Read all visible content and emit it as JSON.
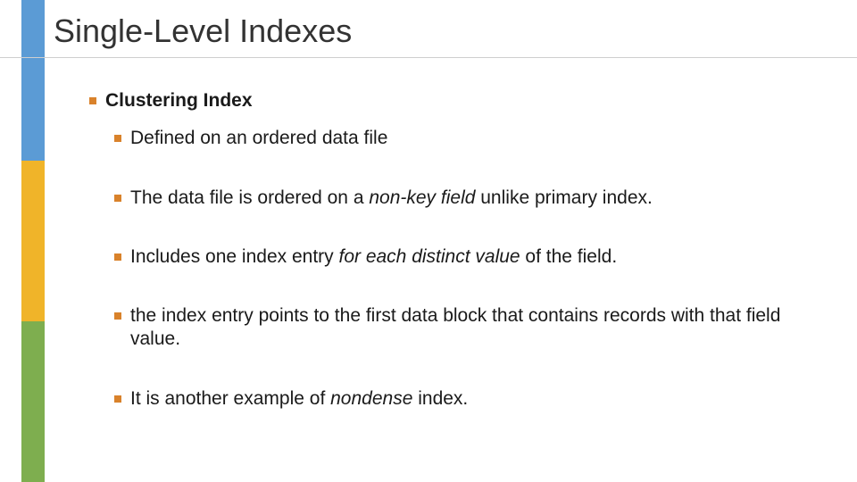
{
  "title": "Single-Level Indexes",
  "heading": "Clustering Index",
  "items": {
    "i1": "Defined on an ordered data file",
    "i2a": "The data file is ordered on a ",
    "i2b": "non-key field",
    "i2c": " unlike primary index.",
    "i3a": "Includes one index entry ",
    "i3b": "for each distinct value",
    "i3c": " of the field.",
    "i4": "the index entry points to the first data block that contains records with that field value.",
    "i5a": "It is another example of ",
    "i5b": "nondense",
    "i5c": " index."
  }
}
